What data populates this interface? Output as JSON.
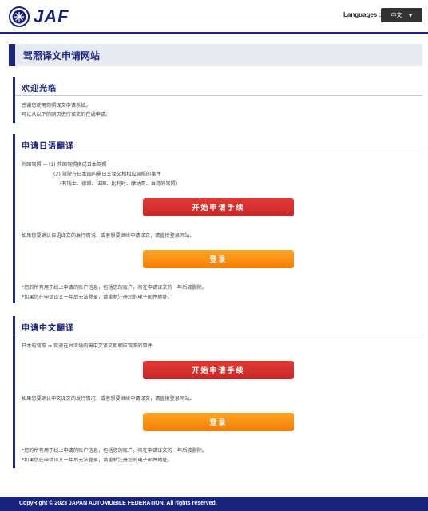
{
  "header": {
    "logo_text": "JAF",
    "languages_label": "Languages :",
    "language_selected": "中文"
  },
  "page_title": "驾照译文申请网站",
  "welcome": {
    "heading": "欢迎光临",
    "line1": "感谢您使用驾照译文申请系统。",
    "line2": "可以从以下的网页进行译文的在线申请。"
  },
  "japanese": {
    "heading": "申请日语翻译",
    "line1": "外国驾照 ⇒ (1) 外国驾照换成日本驾照",
    "line2": "(2) 驾驶在日本国内需日文译文和相应驾照的事件",
    "line3": "(有瑞士、德国、法国、比利时、摩纳哥、台湾的驾照)",
    "start_button": "开始申请手续",
    "check_note": "如果您要确认日语译文的发行情况，或者想要继续申请译文，请直接登录网站。",
    "login_button": "登录",
    "note1": "*您的所有用于线上申请的账户信息，包括您的账户，将在申请译文的一年后被删除。",
    "note2": "*如果您在申请译文一年后无法登录，请重新注册您的电子邮件地址。"
  },
  "chinese": {
    "heading": "申请中文翻译",
    "line1": "日本的驾照 ⇒ 驾驶在台湾境内需中文译文和相应驾照的事件",
    "start_button": "开始申请手续",
    "check_note": "如果您要确认中文译文的发行情况，或者想要继续申请译文，请直接登录网站。",
    "login_button": "登录",
    "note1": "*您的所有用于线上申请的账户信息，包括您的账户，将在申请译文的一年后被删除。",
    "note2": "*如果您在申请译文一年后无法登录，请重新注册您的电子邮件地址。"
  },
  "footer": {
    "copyright": "CopyRight © 2023 JAPAN AUTOMOBILE FEDERATION. All rights reserved."
  }
}
